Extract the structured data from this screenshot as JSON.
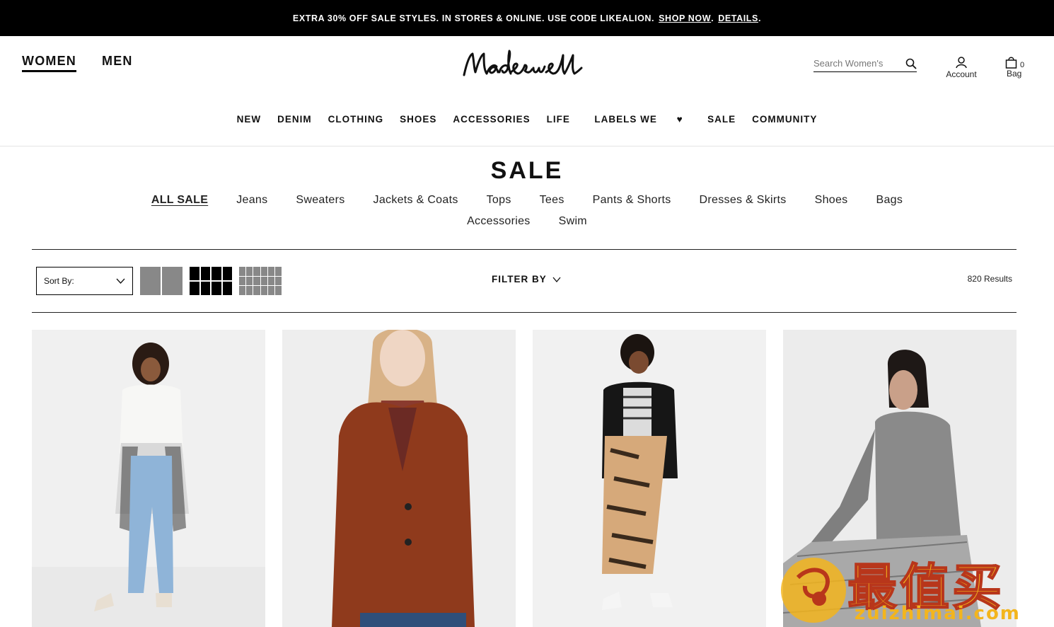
{
  "promo": {
    "text": "EXTRA 30% OFF SALE STYLES. IN STORES & ONLINE. USE CODE LIKEALION.",
    "shop_now": "SHOP NOW",
    "sep": ".",
    "details": "DETAILS",
    "end": "."
  },
  "header": {
    "genders": [
      "WOMEN",
      "MEN"
    ],
    "logo": "Madewell",
    "search_placeholder": "Search Women's",
    "account_label": "Account",
    "bag_label": "Bag",
    "bag_count": "0"
  },
  "main_nav": [
    "NEW",
    "DENIM",
    "CLOTHING",
    "SHOES",
    "ACCESSORIES",
    "LIFE",
    "LABELS WE",
    "SALE",
    "COMMUNITY"
  ],
  "page": {
    "title": "SALE",
    "subnav_row1": [
      "ALL SALE",
      "Jeans",
      "Sweaters",
      "Jackets & Coats",
      "Tops",
      "Tees",
      "Pants & Shorts",
      "Dresses & Skirts",
      "Shoes",
      "Bags"
    ],
    "subnav_row2": [
      "Accessories",
      "Swim"
    ]
  },
  "toolbar": {
    "sort_label": "Sort By:",
    "filter_label": "FILTER BY",
    "results": "820 Results"
  },
  "products": [
    {
      "desc": "white-sweater-jeans-model"
    },
    {
      "desc": "rust-coat-plaid-shirt-model"
    },
    {
      "desc": "black-cardigan-tiger-skirt-model"
    },
    {
      "desc": "grey-turtleneck-plaid-pants-model"
    }
  ],
  "watermark": {
    "brand_cn": "最值买",
    "domain": "zuizhimai.com"
  },
  "colors": {
    "banner_bg": "#000000",
    "accent_gold": "#f3b51d"
  }
}
